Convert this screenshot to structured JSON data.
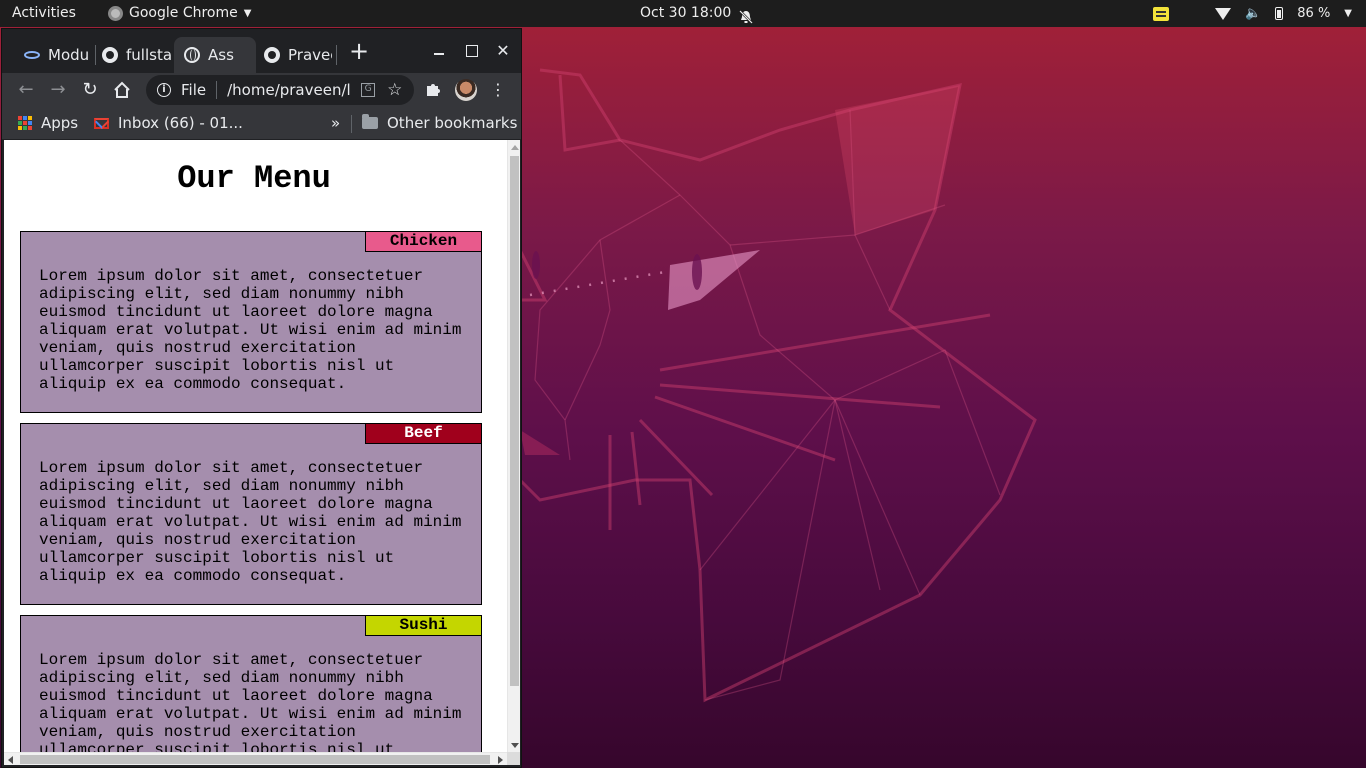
{
  "topbar": {
    "activities": "Activities",
    "app_name": "Google Chrome",
    "clock": "Oct 30  18:00",
    "battery": "86 %"
  },
  "browser": {
    "tabs": [
      {
        "label": "Modu",
        "icon": "infinity-icon"
      },
      {
        "label": "fullsta",
        "icon": "github-icon"
      },
      {
        "label": "Ass",
        "icon": "globe-icon",
        "active": true
      },
      {
        "label": "Praveen",
        "icon": "github-icon"
      }
    ],
    "omnibox": {
      "chip": "File",
      "url": "/home/praveen/l..."
    },
    "bookmarks": {
      "apps": "Apps",
      "inbox": "Inbox (66) - 01...",
      "overflow": "»",
      "other": "Other bookmarks"
    }
  },
  "page": {
    "title": "Our Menu",
    "items": [
      {
        "label": "Chicken",
        "label_color": "#e85a8c",
        "label_text_color": "#000000",
        "text": "Lorem ipsum dolor sit amet, consectetuer adipiscing elit, sed diam nonummy nibh euismod tincidunt ut laoreet dolore magna aliquam erat volutpat. Ut wisi enim ad minim veniam, quis nostrud exercitation ullamcorper suscipit lobortis nisl ut aliquip ex ea commodo consequat."
      },
      {
        "label": "Beef",
        "label_color": "#a0001c",
        "label_text_color": "#ffffff",
        "text": "Lorem ipsum dolor sit amet, consectetuer adipiscing elit, sed diam nonummy nibh euismod tincidunt ut laoreet dolore magna aliquam erat volutpat. Ut wisi enim ad minim veniam, quis nostrud exercitation ullamcorper suscipit lobortis nisl ut aliquip ex ea commodo consequat."
      },
      {
        "label": "Sushi",
        "label_color": "#c4d600",
        "label_text_color": "#000000",
        "text": "Lorem ipsum dolor sit amet, consectetuer adipiscing elit, sed diam nonummy nibh euismod tincidunt ut laoreet dolore magna aliquam erat volutpat. Ut wisi enim ad minim veniam, quis nostrud exercitation ullamcorper suscipit lobortis nisl ut aliquip ex ea commodo consequat."
      }
    ],
    "card_color": "#a58ead"
  }
}
